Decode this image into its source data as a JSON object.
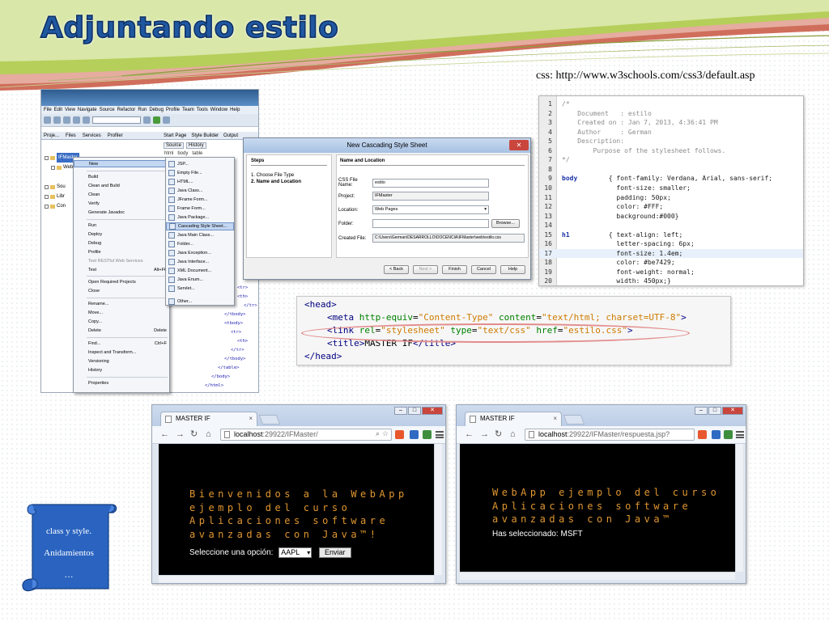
{
  "slide": {
    "title": "Adjuntando estilo",
    "css_reference": "css: http://www.w3schools.com/css3/default.asp",
    "scroll_items": [
      "class y style.",
      "Anidamientos",
      "…"
    ]
  },
  "ide": {
    "menu": [
      "File",
      "Edit",
      "View",
      "Navigate",
      "Source",
      "Refactor",
      "Run",
      "Debug",
      "Profile",
      "Team",
      "Tools",
      "Window",
      "Help"
    ],
    "panel_tabs": [
      "Proje...",
      "Files",
      "Services",
      "Profiler"
    ],
    "editor_tabs": [
      "Start Page",
      "Style Builder",
      "Output"
    ],
    "editor_subtabs": [
      "Source",
      "History"
    ],
    "breadcrumb": [
      "html",
      "body",
      "table"
    ],
    "tree": [
      {
        "label": "IFMaster",
        "selected": true
      },
      {
        "label": "Web",
        "selected": false
      },
      {
        "label": "Sou",
        "selected": false
      },
      {
        "label": "Libr",
        "selected": false
      },
      {
        "label": "Con",
        "selected": false
      }
    ],
    "code_fragments": [
      "<tr>",
      "<th>",
      "</tr>",
      "</tbody>",
      "<tbody>",
      "<tr>",
      "<th>",
      "</tr>",
      "</tbody>",
      "</table>",
      "</body>",
      "</html>"
    ],
    "context_menu": [
      {
        "label": "New",
        "shortcut": "",
        "highlight": true,
        "dim": false
      },
      {
        "label": "Build",
        "shortcut": "",
        "highlight": false,
        "dim": false
      },
      {
        "label": "Clean and Build",
        "shortcut": "",
        "highlight": false,
        "dim": false
      },
      {
        "label": "Clean",
        "shortcut": "",
        "highlight": false,
        "dim": false
      },
      {
        "label": "Verify",
        "shortcut": "",
        "highlight": false,
        "dim": false
      },
      {
        "label": "Generate Javadoc",
        "shortcut": "",
        "highlight": false,
        "dim": false
      },
      {
        "label": "Run",
        "shortcut": "",
        "highlight": false,
        "dim": false
      },
      {
        "label": "Deploy",
        "shortcut": "",
        "highlight": false,
        "dim": false
      },
      {
        "label": "Debug",
        "shortcut": "",
        "highlight": false,
        "dim": false
      },
      {
        "label": "Profile",
        "shortcut": "",
        "highlight": false,
        "dim": false
      },
      {
        "label": "Test RESTful Web Services",
        "shortcut": "",
        "highlight": false,
        "dim": true
      },
      {
        "label": "Test",
        "shortcut": "Alt+F6",
        "highlight": false,
        "dim": false
      },
      {
        "label": "Open Required Projects",
        "shortcut": "",
        "highlight": false,
        "dim": false
      },
      {
        "label": "Close",
        "shortcut": "",
        "highlight": false,
        "dim": false
      },
      {
        "label": "Rename...",
        "shortcut": "",
        "highlight": false,
        "dim": false
      },
      {
        "label": "Move...",
        "shortcut": "",
        "highlight": false,
        "dim": false
      },
      {
        "label": "Copy...",
        "shortcut": "",
        "highlight": false,
        "dim": false
      },
      {
        "label": "Delete",
        "shortcut": "Delete",
        "highlight": false,
        "dim": false
      },
      {
        "label": "Find...",
        "shortcut": "Ctrl+F",
        "highlight": false,
        "dim": false
      },
      {
        "label": "Inspect and Transform...",
        "shortcut": "",
        "highlight": false,
        "dim": false
      },
      {
        "label": "Versioning",
        "shortcut": "",
        "highlight": false,
        "dim": false
      },
      {
        "label": "History",
        "shortcut": "",
        "highlight": false,
        "dim": false
      },
      {
        "label": "Properties",
        "shortcut": "",
        "highlight": false,
        "dim": false
      }
    ],
    "submenu": [
      {
        "label": "JSP...",
        "highlight": false
      },
      {
        "label": "Empty File...",
        "highlight": false
      },
      {
        "label": "HTML...",
        "highlight": false
      },
      {
        "label": "Java Class...",
        "highlight": false
      },
      {
        "label": "JFrame Form...",
        "highlight": false
      },
      {
        "label": "Frame Form...",
        "highlight": false
      },
      {
        "label": "Java Package...",
        "highlight": false
      },
      {
        "label": "Cascading Style Sheet...",
        "highlight": true
      },
      {
        "label": "Java Main Class...",
        "highlight": false
      },
      {
        "label": "Folder...",
        "highlight": false
      },
      {
        "label": "Java Exception...",
        "highlight": false
      },
      {
        "label": "Java Interface...",
        "highlight": false
      },
      {
        "label": "XML Document...",
        "highlight": false
      },
      {
        "label": "Java Enum...",
        "highlight": false
      },
      {
        "label": "Servlet...",
        "highlight": false
      },
      {
        "label": "Other...",
        "highlight": false
      }
    ]
  },
  "dialog": {
    "title": "New Cascading Style Sheet",
    "steps_heading": "Steps",
    "steps": [
      "1.   Choose File Type",
      "2.   Name and Location"
    ],
    "section_heading": "Name and Location",
    "fields": [
      {
        "label": "CSS File Name:",
        "value": "estilo",
        "kind": "input"
      },
      {
        "label": "Project:",
        "value": "IFMaster",
        "kind": "readonly"
      },
      {
        "label": "Location:",
        "value": "Web Pages",
        "kind": "select"
      },
      {
        "label": "Folder:",
        "value": "",
        "kind": "input"
      },
      {
        "label": "Created File:",
        "value": "C:\\Users\\German\\DESARROLLO\\DOCENCIA\\IFMaster\\web\\estilo.css",
        "kind": "readonly"
      }
    ],
    "browse_label": "Browse...",
    "buttons": {
      "back": "< Back",
      "next": "Next >",
      "finish": "Finish",
      "cancel": "Cancel",
      "help": "Help"
    }
  },
  "css_code": {
    "lines": [
      {
        "n": "1",
        "text": "/*",
        "kind": "com"
      },
      {
        "n": "2",
        "text": "    Document   : estilo",
        "kind": "com"
      },
      {
        "n": "3",
        "text": "    Created on : Jan 7, 2013, 4:36:41 PM",
        "kind": "com"
      },
      {
        "n": "4",
        "text": "    Author     : German",
        "kind": "com"
      },
      {
        "n": "5",
        "text": "    Description:",
        "kind": "com"
      },
      {
        "n": "6",
        "text": "        Purpose of the stylesheet follows.",
        "kind": "com"
      },
      {
        "n": "7",
        "text": "*/",
        "kind": "com"
      },
      {
        "n": "8",
        "text": "",
        "kind": "prop"
      },
      {
        "n": "9",
        "text": "body",
        "rest": "        { font-family: Verdana, Arial, sans-serif;",
        "kind": "sel"
      },
      {
        "n": "10",
        "text": "              font-size: smaller;",
        "kind": "prop"
      },
      {
        "n": "11",
        "text": "              padding: 50px;",
        "kind": "prop"
      },
      {
        "n": "12",
        "text": "              color: #FFF;",
        "kind": "prop"
      },
      {
        "n": "13",
        "text": "              background:#000}",
        "kind": "prop"
      },
      {
        "n": "14",
        "text": "",
        "kind": "prop"
      },
      {
        "n": "15",
        "text": "h1",
        "rest": "          { text-align: left;",
        "kind": "sel"
      },
      {
        "n": "16",
        "text": "              letter-spacing: 6px;",
        "kind": "prop"
      },
      {
        "n": "17",
        "text": "              font-size: 1.4em;",
        "kind": "prop",
        "hl": true
      },
      {
        "n": "18",
        "text": "              color: #be7429;",
        "kind": "prop"
      },
      {
        "n": "19",
        "text": "              font-weight: normal;",
        "kind": "prop"
      },
      {
        "n": "20",
        "text": "              width: 450px;}",
        "kind": "prop"
      }
    ]
  },
  "html_head": {
    "open": "<head>",
    "meta": {
      "tag": "<meta",
      "a1": "http-equiv",
      "v1": "\"Content-Type\"",
      "a2": "content",
      "v2": "\"text/html; charset=UTF-8\"",
      "end": ">"
    },
    "link": {
      "tag": "<link",
      "a1": "rel",
      "v1": "\"stylesheet\"",
      "a2": "type",
      "v2": "\"text/css\"",
      "a3": "href",
      "v3": "\"estilo.css\"",
      "end": ">"
    },
    "title": {
      "open": "<title>",
      "text": "MASTER IF",
      "close": "</title>"
    },
    "close": "</head>"
  },
  "browser1": {
    "tab": "MASTER IF",
    "host": "localhost",
    "path": ":29922/IFMaster/",
    "heading_lines": [
      "Bienvenidos a la WebApp",
      "ejemplo del curso",
      "Aplicaciones software",
      "avanzadas con Java™!"
    ],
    "prompt": "Seleccione una opción:",
    "select_value": "AAPL",
    "submit": "Enviar"
  },
  "browser2": {
    "tab": "MASTER IF",
    "host": "localhost",
    "path": ":29922/IFMaster/respuesta.jsp?",
    "heading_lines": [
      "WebApp ejemplo del curso",
      "Aplicaciones software",
      "avanzadas con Java™"
    ],
    "result": "Has seleccionado: MSFT"
  },
  "colors": {
    "title_blue": "#1f57a0",
    "accent_orange": "#e0962f",
    "swoosh_green": "#b5cf5a",
    "swoosh_red": "#c8553f",
    "scroll_blue": "#2a64c0"
  }
}
